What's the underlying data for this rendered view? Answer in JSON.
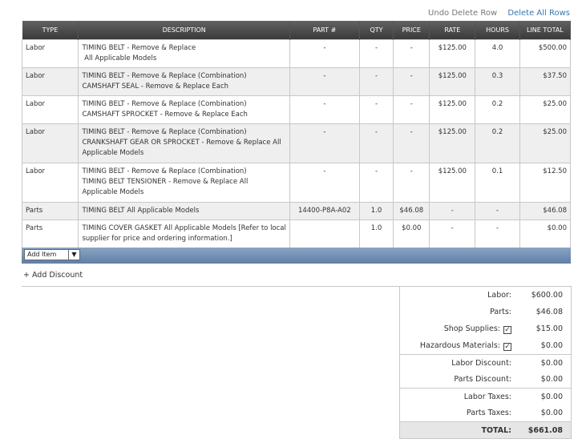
{
  "actions": {
    "undo": "Undo Delete Row",
    "delete_all": "Delete All Rows"
  },
  "columns": [
    "TYPE",
    "DESCRIPTION",
    "PART #",
    "QTY",
    "PRICE",
    "RATE",
    "HOURS",
    "LINE TOTAL"
  ],
  "rows": [
    {
      "type": "Labor",
      "desc": [
        "TIMING BELT - Remove & Replace",
        " All Applicable Models"
      ],
      "part": "-",
      "qty": "-",
      "price": "-",
      "rate": "$125.00",
      "hours": "4.0",
      "total": "$500.00"
    },
    {
      "type": "Labor",
      "desc": [
        "TIMING BELT - Remove & Replace (Combination)",
        "CAMSHAFT SEAL - Remove & Replace Each"
      ],
      "part": "-",
      "qty": "-",
      "price": "-",
      "rate": "$125.00",
      "hours": "0.3",
      "total": "$37.50"
    },
    {
      "type": "Labor",
      "desc": [
        "TIMING BELT - Remove & Replace (Combination)",
        "CAMSHAFT SPROCKET - Remove & Replace Each"
      ],
      "part": "-",
      "qty": "-",
      "price": "-",
      "rate": "$125.00",
      "hours": "0.2",
      "total": "$25.00"
    },
    {
      "type": "Labor",
      "desc": [
        "TIMING BELT - Remove & Replace (Combination)",
        "CRANKSHAFT GEAR OR SPROCKET - Remove & Replace All",
        "Applicable Models"
      ],
      "part": "-",
      "qty": "-",
      "price": "-",
      "rate": "$125.00",
      "hours": "0.2",
      "total": "$25.00"
    },
    {
      "type": "Labor",
      "desc": [
        "TIMING BELT - Remove & Replace (Combination)",
        "TIMING BELT TENSIONER - Remove & Replace All",
        "Applicable Models"
      ],
      "part": "-",
      "qty": "-",
      "price": "-",
      "rate": "$125.00",
      "hours": "0.1",
      "total": "$12.50"
    },
    {
      "type": "Parts",
      "desc": [
        "TIMING BELT All Applicable Models"
      ],
      "part": "14400-P8A-A02",
      "qty": "1.0",
      "price": "$46.08",
      "rate": "-",
      "hours": "-",
      "total": "$46.08"
    },
    {
      "type": "Parts",
      "desc": [
        "TIMING COVER GASKET All Applicable Models [Refer to local",
        "supplier for price and ordering information.]"
      ],
      "part": "",
      "qty": "1.0",
      "price": "$0.00",
      "rate": "-",
      "hours": "-",
      "total": "$0.00"
    }
  ],
  "add_item": {
    "selected": "Add Item",
    "arrow": "▼"
  },
  "add_discount": "+ Add Discount",
  "totals": {
    "labor": {
      "label": "Labor:",
      "value": "$600.00"
    },
    "parts": {
      "label": "Parts:",
      "value": "$46.08"
    },
    "shop_supplies": {
      "label": "Shop Supplies:",
      "value": "$15.00",
      "check": "✓"
    },
    "hazardous": {
      "label": "Hazardous Materials:",
      "value": "$0.00",
      "check": "✓"
    },
    "labor_discount": {
      "label": "Labor Discount:",
      "value": "$0.00"
    },
    "parts_discount": {
      "label": "Parts Discount:",
      "value": "$0.00"
    },
    "labor_taxes": {
      "label": "Labor Taxes:",
      "value": "$0.00"
    },
    "parts_taxes": {
      "label": "Parts Taxes:",
      "value": "$0.00"
    },
    "total": {
      "label": "TOTAL:",
      "value": "$661.08"
    }
  }
}
